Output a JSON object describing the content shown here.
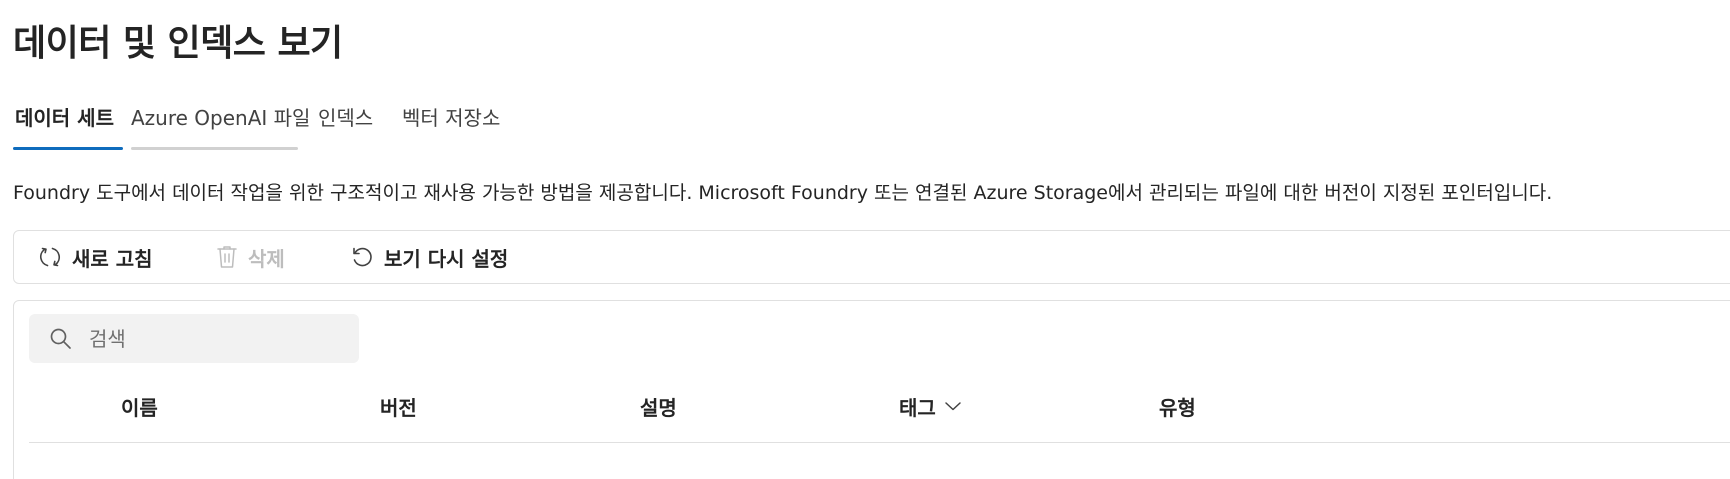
{
  "page": {
    "title": "데이터 및 인덱스 보기",
    "description": "Foundry 도구에서 데이터 작업을 위한 구조적이고 재사용 가능한 방법을 제공합니다. Microsoft Foundry 또는 연결된 Azure Storage에서 관리되는 파일에 대한 버전이 지정된 포인터입니다."
  },
  "tabs": [
    {
      "label": "데이터 세트",
      "state": "selected"
    },
    {
      "label": "Azure OpenAI 파일",
      "state": "hover"
    },
    {
      "label": "인덱스",
      "state": "default"
    },
    {
      "label": "벡터 저장소",
      "state": "default"
    }
  ],
  "toolbar": {
    "refresh": {
      "label": "새로 고침",
      "icon": "refresh-icon",
      "enabled": true
    },
    "delete": {
      "label": "삭제",
      "icon": "trash-icon",
      "enabled": false
    },
    "reset_view": {
      "label": "보기 다시 설정",
      "icon": "reset-icon",
      "enabled": true
    }
  },
  "search": {
    "placeholder": "검색",
    "value": "",
    "icon": "search-icon"
  },
  "table": {
    "columns": [
      {
        "label": "이름",
        "sortable": false
      },
      {
        "label": "버전",
        "sortable": false
      },
      {
        "label": "설명",
        "sortable": false
      },
      {
        "label": "태그",
        "sortable": true,
        "icon": "chevron-down-icon"
      },
      {
        "label": "유형",
        "sortable": false
      }
    ],
    "rows": []
  },
  "colors": {
    "accent": "#0f6cbd",
    "text": "#242424",
    "border": "#e0e0e0",
    "disabled": "#bdbdbd",
    "search_bg": "#f2f2f2"
  }
}
